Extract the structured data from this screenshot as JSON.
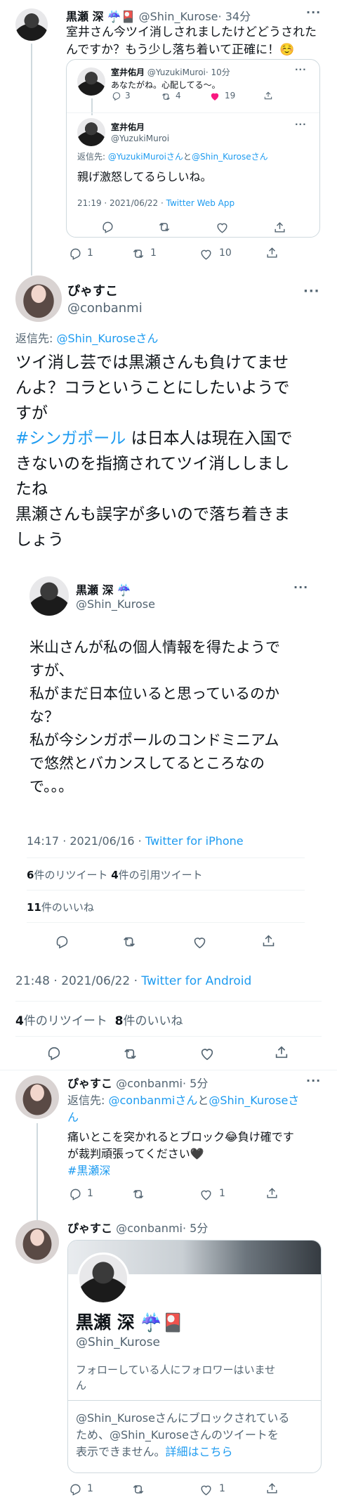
{
  "tweet1": {
    "name": "黒瀬 深",
    "emoji": "☔️🎴",
    "handle": "@Shin_Kurose",
    "time": "· 34分",
    "text": "室井さん今ツイ消しされましたけどどうされたんですか？もう少し落ち着いて正確に！☺️",
    "quote": {
      "header": {
        "name": "室井佑月",
        "handle": "@YuzukiMuroi",
        "time": "· 10分",
        "text": "あなたがね。心配してる〜。",
        "reply_count": "3",
        "retweet_count": "4",
        "like_count": "19"
      },
      "main": {
        "name": "室井佑月",
        "handle": "@YuzukiMuroi",
        "reply_to_prefix": "返信先: ",
        "reply_to_user1": "@YuzukiMuroiさん",
        "reply_to_mid": "と",
        "reply_to_user2": "@Shin_Kuroseさん",
        "text": "親げ激怒してるらしいね。",
        "timestamp": "21:19 · 2021/06/22 · ",
        "source": "Twitter Web App"
      }
    },
    "reply_count": "1",
    "retweet_count": "1",
    "like_count": "10"
  },
  "main_tweet": {
    "name": "ぴゃすこ",
    "handle": "@conbanmi",
    "reply_to_prefix": "返信先: ",
    "reply_to_user": "@Shin_Kuroseさん",
    "text_lines": [
      "ツイ消し芸では黒瀬さんも負けてませ",
      "んよ？コラということにしたいようで",
      "すが",
      "#シンガポール",
      " は日本人は現在入国で",
      "きないのを指摘されてツイ消ししまし",
      "たね",
      "黒瀬さんも誤字が多いので落ち着きま",
      "しょう"
    ],
    "quote": {
      "name": "黒瀬 深",
      "emoji": "☔️",
      "handle": "@Shin_Kurose",
      "text_lines": [
        "米山さんが私の個人情報を得たようで",
        "すが、",
        "私がまだ日本位いると思っているのか",
        "な？",
        "私が今シンガポールのコンドミニアム",
        "で悠然とバカンスしてるところなの",
        "で。。。"
      ],
      "timestamp": "14:17 · 2021/06/16 · ",
      "source": "Twitter for iPhone",
      "retweets_num": "6",
      "retweets_label": "件のリツイート",
      "quotes_num": "4",
      "quotes_label": "件の引用ツイート",
      "likes_num": "11",
      "likes_label": "件のいいね"
    },
    "timestamp": "21:48 · 2021/06/22 · ",
    "source": "Twitter for Android",
    "retweets_num": "4",
    "retweets_label": "件のリツイート",
    "likes_num": "8",
    "likes_label": "件のいいね"
  },
  "reply1": {
    "name": "ぴゃすこ",
    "handle": "@conbanmi",
    "time": "· 5分",
    "reply_to_prefix": "返信先: ",
    "reply_to_user1": "@conbanmiさん",
    "reply_to_mid": "と",
    "reply_to_user2": "@Shin_Kuroseさ",
    "reply_to_user2b": "ん",
    "text_line1": "痛いとこを突かれるとブロック😂負け確です",
    "text_line2": "が裁判頑張ってください🖤",
    "hashtag": "#黒瀬深",
    "reply_count": "1",
    "like_count": "1"
  },
  "reply2": {
    "name": "ぴゃすこ",
    "handle": "@conbanmi",
    "time": "· 5分",
    "card": {
      "name": "黒瀬 深",
      "emoji": "☔️🎴",
      "handle": "@Shin_Kurose",
      "bio_line1": "フォローしている人にフォロワーはいませ",
      "bio_line2": "ん",
      "blocked_line1": "@Shin_Kuroseさんにブロックされている",
      "blocked_line2": "ため、@Shin_Kuroseさんのツイートを",
      "blocked_line3": "表示できません。",
      "blocked_link": "詳細はこちら"
    },
    "reply_count": "1",
    "like_count": "1"
  }
}
